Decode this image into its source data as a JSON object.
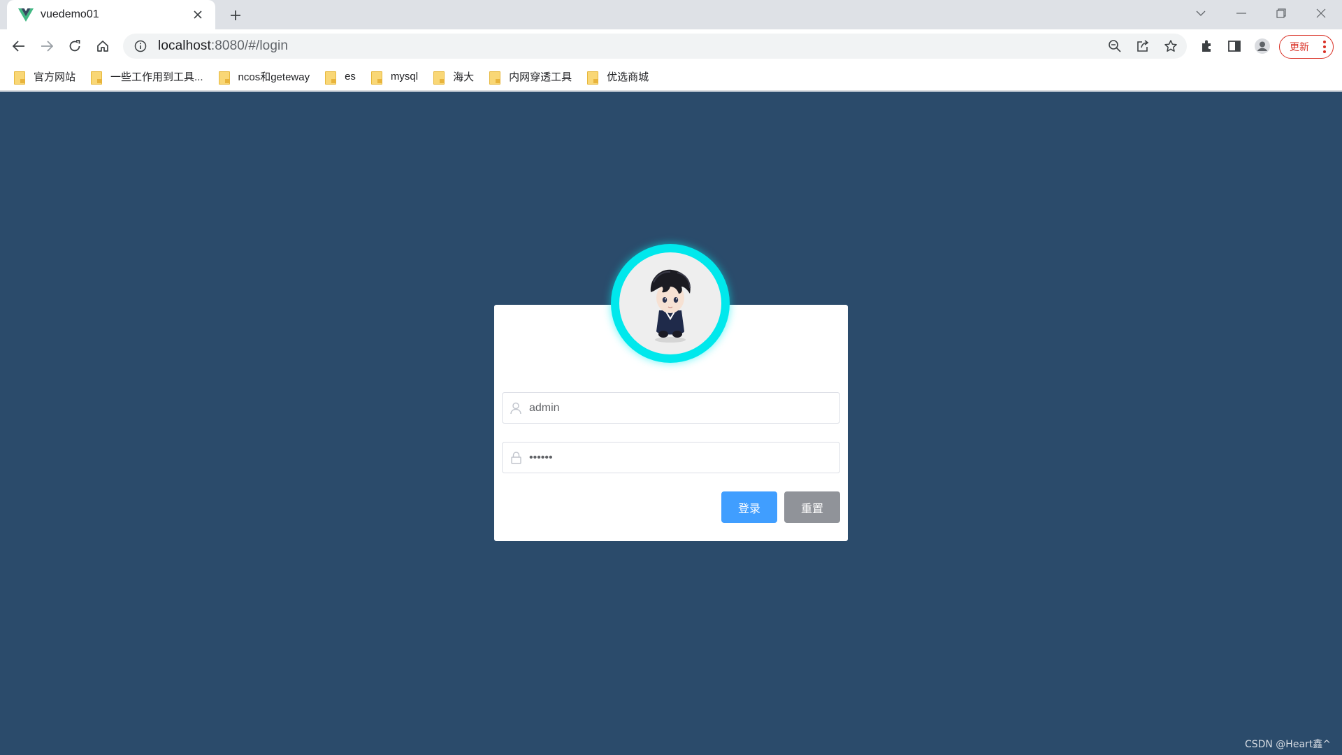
{
  "browser": {
    "tab": {
      "title": "vuedemo01",
      "favicon": "vue-logo-icon"
    },
    "address_bar": {
      "host": "localhost",
      "path": ":8080/#/login"
    },
    "update_label": "更新",
    "bookmarks": [
      {
        "label": "官方网站"
      },
      {
        "label": "一些工作用到工具..."
      },
      {
        "label": "ncos和geteway"
      },
      {
        "label": "es"
      },
      {
        "label": "mysql"
      },
      {
        "label": "海大"
      },
      {
        "label": "内网穿透工具"
      },
      {
        "label": "优选商城"
      }
    ]
  },
  "login": {
    "username": {
      "value": "admin",
      "icon": "user-icon"
    },
    "password": {
      "value": "123456",
      "icon": "lock-icon"
    },
    "login_button": "登录",
    "reset_button": "重置",
    "colors": {
      "background": "#2b4b6b",
      "primary": "#409eff",
      "info": "#909399",
      "avatar_ring": "#00e8ec"
    }
  },
  "watermark": "CSDN @Heart鑫^"
}
